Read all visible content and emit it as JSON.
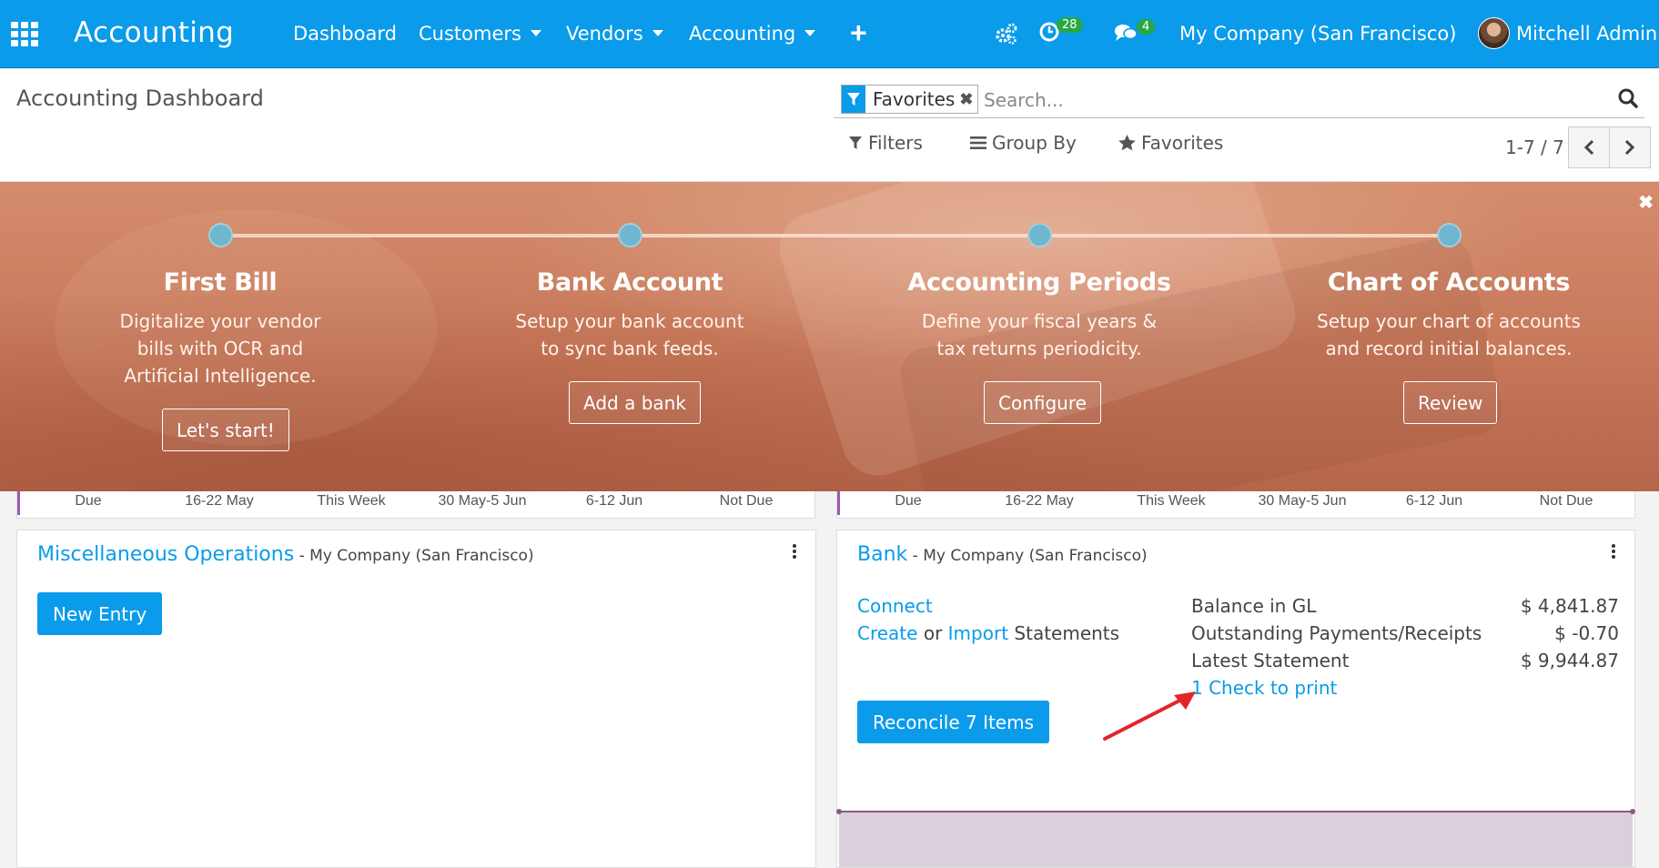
{
  "navbar": {
    "brand": "Accounting",
    "menus": [
      {
        "label": "Dashboard",
        "dropdown": false
      },
      {
        "label": "Customers",
        "dropdown": true
      },
      {
        "label": "Vendors",
        "dropdown": true
      },
      {
        "label": "Accounting",
        "dropdown": true
      }
    ],
    "activity_count": "28",
    "message_count": "4",
    "company": "My Company (San Francisco)",
    "user": "Mitchell Admin",
    "accent_color": "#0a9bea"
  },
  "control_panel": {
    "title": "Accounting Dashboard",
    "facet_label": "Favorites",
    "search_placeholder": "Search...",
    "filters_label": "Filters",
    "group_by_label": "Group By",
    "favorites_label": "Favorites",
    "pager": "1-7 / 7"
  },
  "onboarding": {
    "steps": [
      {
        "title": "First Bill",
        "description": "Digitalize your vendor bills with OCR and Artificial Intelligence.",
        "button": "Let's start!"
      },
      {
        "title": "Bank Account",
        "description": "Setup your bank account to sync bank feeds.",
        "button": "Add a bank"
      },
      {
        "title": "Accounting Periods",
        "description": "Define your fiscal years & tax returns periodicity.",
        "button": "Configure"
      },
      {
        "title": "Chart of Accounts",
        "description": "Setup your chart of accounts and record initial balances.",
        "button": "Review"
      }
    ]
  },
  "aging_labels": [
    "Due",
    "16-22 May",
    "This Week",
    "30 May-5 Jun",
    "6-12 Jun",
    "Not Due"
  ],
  "misc_card": {
    "title": "Miscellaneous Operations",
    "company": " - My Company (San Francisco)",
    "new_entry": "New Entry"
  },
  "bank_card": {
    "title": "Bank",
    "company": " - My Company (San Francisco)",
    "connect": "Connect",
    "create": "Create",
    "or": " or ",
    "import": "Import",
    "statements": " Statements",
    "reconcile": "Reconcile 7 Items",
    "stats": [
      {
        "label": "Balance in GL",
        "value": "$ 4,841.87"
      },
      {
        "label": "Outstanding Payments/Receipts",
        "value": "$ -0.70"
      },
      {
        "label": "Latest Statement",
        "value": "$ 9,944.87"
      }
    ],
    "checks_to_print": "1 Check to print"
  },
  "icons": [
    "apps-grid-icon",
    "settings-gears-icon",
    "activity-clock-icon",
    "chat-icon",
    "filter-icon",
    "search-icon",
    "bars-icon",
    "star-icon",
    "chevron-left-icon",
    "chevron-right-icon",
    "close-icon",
    "kebab-menu-icon",
    "red-arrow-annotation"
  ]
}
